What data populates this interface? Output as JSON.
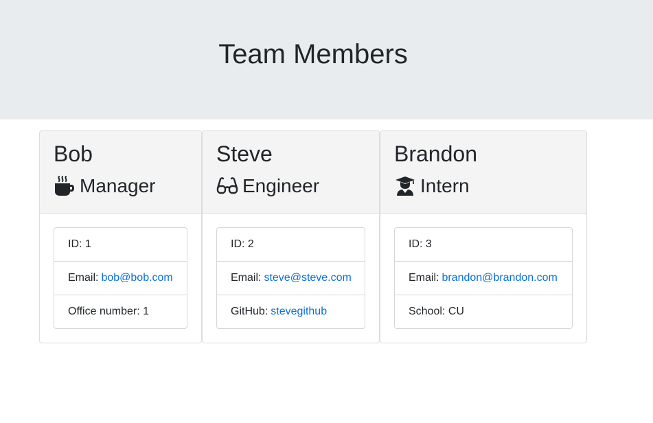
{
  "header": {
    "title": "Team Members"
  },
  "members": [
    {
      "name": "Bob",
      "role": "Manager",
      "icon": "mug-hot-icon",
      "id_label": "ID: 1",
      "email_prefix": "Email:",
      "email": "bob@bob.com",
      "extra_prefix": "Office number: 1",
      "extra_link": ""
    },
    {
      "name": "Steve",
      "role": "Engineer",
      "icon": "glasses-icon",
      "id_label": "ID: 2",
      "email_prefix": "Email:",
      "email": "steve@steve.com",
      "extra_prefix": "GitHub:",
      "extra_link": "stevegithub"
    },
    {
      "name": "Brandon",
      "role": "Intern",
      "icon": "graduate-icon",
      "id_label": "ID: 3",
      "email_prefix": "Email:",
      "email": "brandon@brandon.com",
      "extra_prefix": "School: CU",
      "extra_link": ""
    }
  ],
  "colors": {
    "link": "#0a6fd9",
    "jumbotron_bg": "#e9ecef",
    "card_header_bg": "#f4f4f4",
    "text": "#212529"
  }
}
